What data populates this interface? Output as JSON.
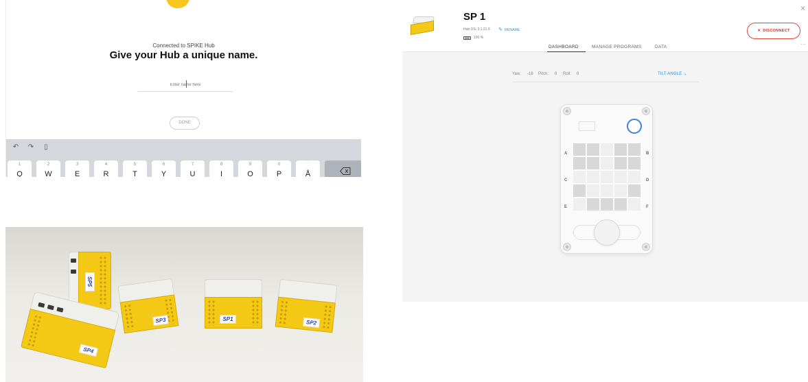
{
  "rename_screen": {
    "connected_text": "Connected to SPIKE Hub",
    "heading": "Give your Hub a unique name.",
    "input_placeholder": "Enter name here",
    "done_label": "DONE",
    "keyboard": {
      "toolbar_icons": [
        "undo-icon",
        "redo-icon",
        "clipboard-icon"
      ],
      "keys": [
        {
          "num": "1",
          "letter": "Q"
        },
        {
          "num": "2",
          "letter": "W"
        },
        {
          "num": "3",
          "letter": "E"
        },
        {
          "num": "4",
          "letter": "R"
        },
        {
          "num": "5",
          "letter": "T"
        },
        {
          "num": "6",
          "letter": "Y"
        },
        {
          "num": "7",
          "letter": "U"
        },
        {
          "num": "8",
          "letter": "I"
        },
        {
          "num": "9",
          "letter": "O"
        },
        {
          "num": "0",
          "letter": "P"
        },
        {
          "num": "¨",
          "letter": "Å"
        }
      ],
      "backspace_icon": "backspace-icon"
    }
  },
  "photo": {
    "hub_labels": [
      "SP5",
      "SP4",
      "SP3",
      "SP1",
      "SP2"
    ]
  },
  "dashboard": {
    "hub_name": "SP 1",
    "hub_os": "Hub OS: 3.1.21.9",
    "rename_label": "RENAME",
    "battery": "100 %",
    "disconnect_label": "DISCONNECT",
    "tabs": [
      "DASHBOARD",
      "MANAGE PROGRAMS",
      "DATA"
    ],
    "active_tab": "DASHBOARD",
    "sensors": {
      "yaw_label": "Yaw:",
      "yaw_value": "-18",
      "pitch_label": "Pitch:",
      "pitch_value": "0",
      "roll_label": "Roll:",
      "roll_value": "0"
    },
    "tilt_select": "TILT ANGLE",
    "ports": [
      "A",
      "B",
      "C",
      "D",
      "E",
      "F"
    ],
    "matrix_on": [
      [
        1,
        1,
        0,
        1,
        1
      ],
      [
        1,
        1,
        0,
        1,
        1
      ],
      [
        0,
        0,
        0,
        0,
        0
      ],
      [
        1,
        0,
        0,
        0,
        1
      ],
      [
        0,
        1,
        1,
        1,
        0
      ]
    ],
    "colors": {
      "accent_red": "#d0332a",
      "link_blue": "#2c8fd6",
      "ring_blue": "#3b82e6",
      "hub_yellow": "#f4c916"
    }
  }
}
